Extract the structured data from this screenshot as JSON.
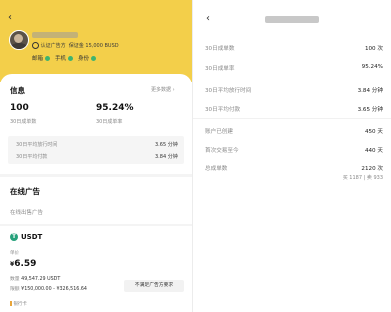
{
  "merchant": {
    "verified_label": "认证广告方",
    "deposit_label": "保证金",
    "deposit_value": "15,000 BUSD",
    "verifications": [
      "邮箱",
      "手机",
      "身份"
    ]
  },
  "info": {
    "title": "信息",
    "more_link": "更多数据",
    "trades_value": "100",
    "trades_label": "30日成单数",
    "rate_value": "95.24%",
    "rate_label": "30日成单率",
    "pay_time_label": "30日平均放行时间",
    "pay_time_value": "3.65 分钟",
    "pay_label": "30日平均付款",
    "pay_value": "3.84 分钟"
  },
  "ads": {
    "online_title": "在线广告",
    "sell_label": "在线出售广告",
    "asset": "USDT",
    "price_label": "单价",
    "currency_symbol": "¥",
    "price": "6.59",
    "amount_label": "数量",
    "amount_value": "49,547.29 USDT",
    "limit_label": "限额",
    "limit_value": "¥150,000.00 - ¥326,516.64",
    "payment_label": "银行卡",
    "action_button": "不满足广告方要求"
  },
  "stats": {
    "rows": [
      {
        "label": "30日成单数",
        "value": "100 次"
      },
      {
        "label": "30日成单率",
        "value": "95.24%"
      },
      {
        "label": "30日平均放行时间",
        "value": "3.84 分钟"
      },
      {
        "label": "30日平均付款",
        "value": "3.65 分钟"
      },
      {
        "label": "账户已创建",
        "value": "450 天"
      },
      {
        "label": "首次交易至今",
        "value": "440 天"
      },
      {
        "label": "总成单数",
        "value": "2120 次"
      }
    ],
    "breakdown": "买 1187 | 卖 933"
  }
}
